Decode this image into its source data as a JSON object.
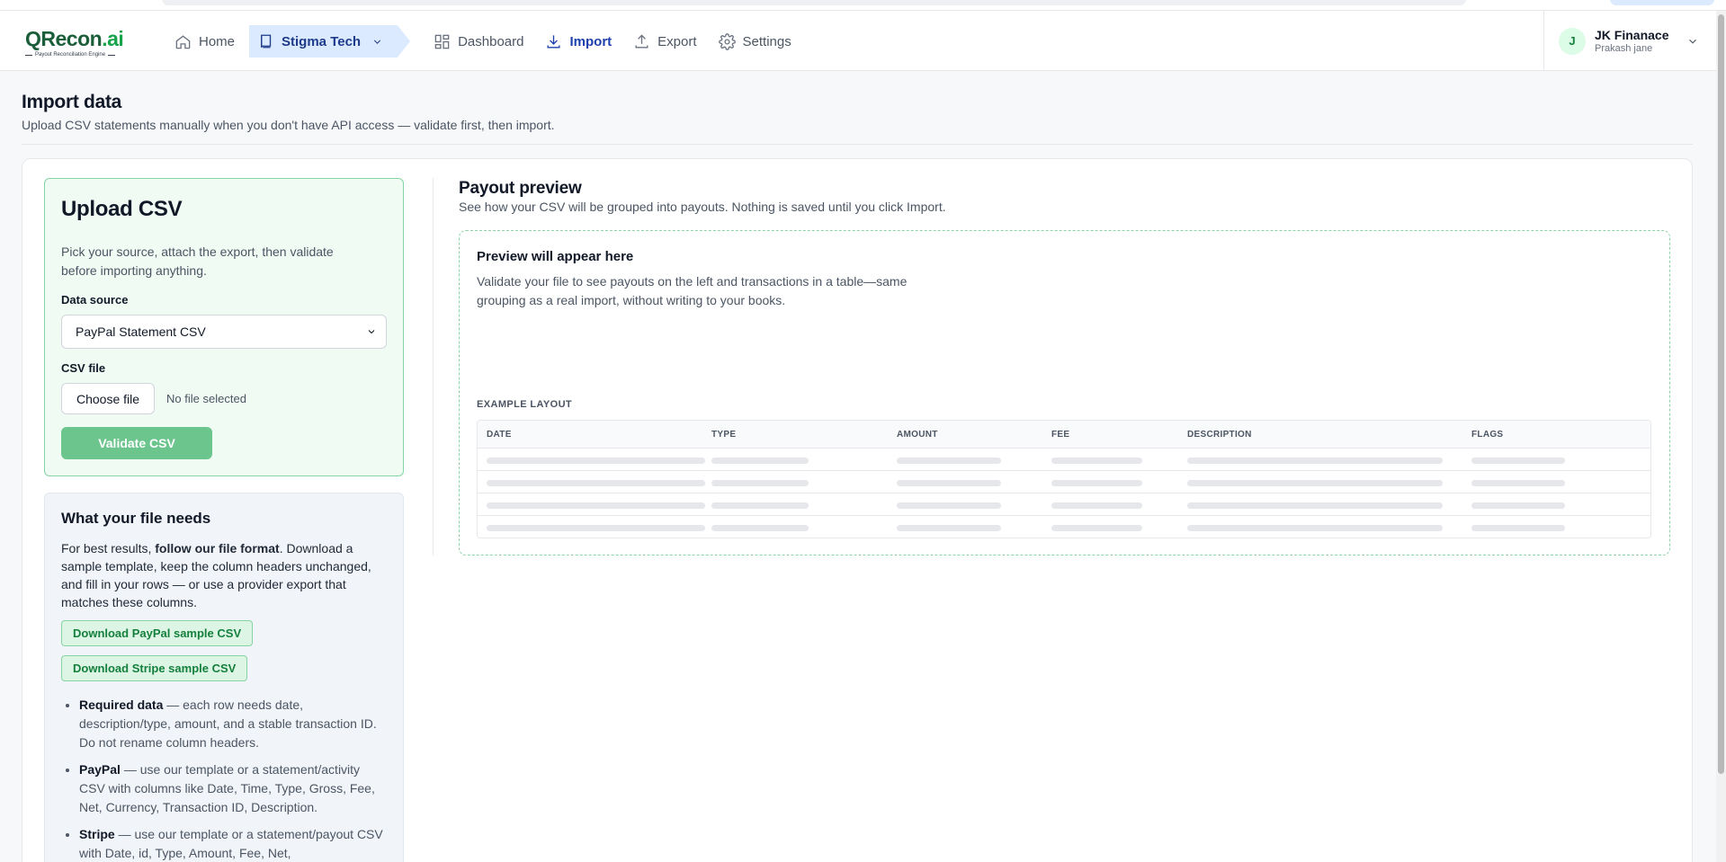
{
  "brand": {
    "name_main": "QRecon",
    "name_suffix": ".ai",
    "tagline": "Payout Reconciliation Engine",
    "color": "#1b5e3a"
  },
  "nav": {
    "home": "Home",
    "org": "Stigma Tech",
    "dashboard": "Dashboard",
    "import": "Import",
    "export": "Export",
    "settings": "Settings",
    "active": "Import"
  },
  "account": {
    "initial": "J",
    "name": "JK Finanace",
    "user": "Prakash jane"
  },
  "page": {
    "title": "Import data",
    "subtitle": "Upload CSV statements manually when you don't have API access — validate first, then import."
  },
  "upload": {
    "title": "Upload CSV",
    "description": "Pick your source, attach the export, then validate before importing anything.",
    "source_label": "Data source",
    "source_value": "PayPal Statement CSV",
    "file_label": "CSV file",
    "choose_file": "Choose file",
    "no_file": "No file selected",
    "validate": "Validate CSV"
  },
  "needs": {
    "title": "What your file needs",
    "intro_pre": "For best results, ",
    "intro_bold": "follow our file format",
    "intro_post": ". Download a sample template, keep the column headers unchanged, and fill in your rows — or use a provider export that matches these columns.",
    "download_paypal": "Download PayPal sample CSV",
    "download_stripe": "Download Stripe sample CSV",
    "items": [
      {
        "bold": "Required data",
        "text": " — each row needs date, description/type, amount, and a stable transaction ID. Do not rename column headers."
      },
      {
        "bold": "PayPal",
        "text": " — use our template or a statement/activity CSV with columns like Date, Time, Type, Gross, Fee, Net, Currency, Transaction ID, Description."
      },
      {
        "bold": "Stripe",
        "text": " — use our template or a statement/payout CSV with Date, id, Type, Amount, Fee, Net,"
      }
    ]
  },
  "preview": {
    "title": "Payout preview",
    "subtitle": "See how your CSV will be grouped into payouts. Nothing is saved until you click Import.",
    "placeholder_title": "Preview will appear here",
    "placeholder_desc": "Validate your file to see payouts on the left and transactions in a table—same grouping as a real import, without writing to your books.",
    "example_label": "EXAMPLE LAYOUT",
    "columns": [
      "DATE",
      "TYPE",
      "AMOUNT",
      "FEE",
      "DESCRIPTION",
      "FLAGS"
    ]
  },
  "colors": {
    "accent": "#1e40af",
    "success": "#16a34a",
    "validate_button": "#6cc58d"
  },
  "icons": [
    "home-icon",
    "book-icon",
    "chevron-down-icon",
    "dashboard-icon",
    "download-icon",
    "upload-icon",
    "gear-icon"
  ]
}
